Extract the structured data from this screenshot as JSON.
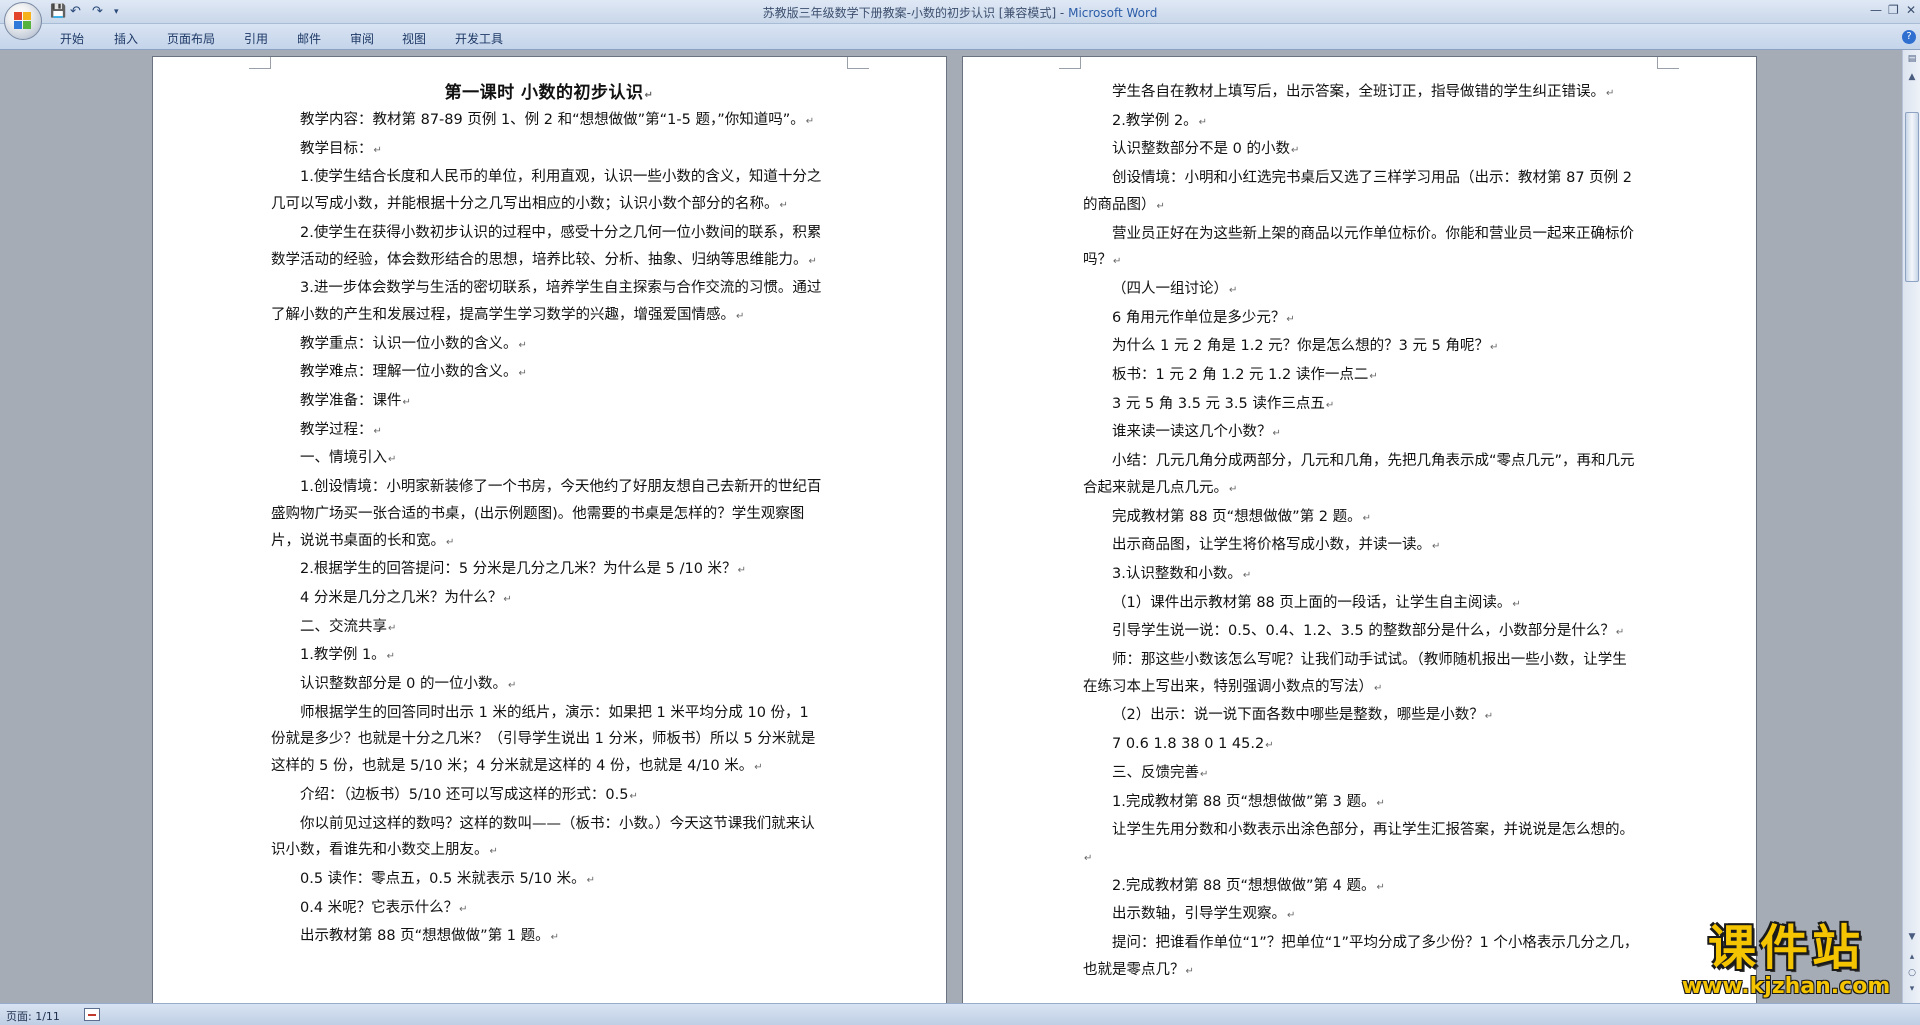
{
  "window": {
    "title_doc": "苏教版三年级数学下册教案-小数的初步认识 [兼容模式] - ",
    "title_app": "Microsoft Word"
  },
  "ribbon": {
    "tabs": [
      "开始",
      "插入",
      "页面布局",
      "引用",
      "邮件",
      "审阅",
      "视图",
      "开发工具"
    ]
  },
  "left_page": {
    "heading": "第一课时    小数的初步认识",
    "paragraphs": [
      {
        "text": "教学内容：教材第 87-89 页例 1、例 2 和“想想做做”第“1-5 题，”你知道吗”。",
        "indent": true
      },
      {
        "text": "教学目标：",
        "indent": true
      },
      {
        "text": "1.使学生结合长度和人民币的单位，利用直观，认识一些小数的含义，知道十分之几可以写成小数，并能根据十分之几写出相应的小数；认识小数个部分的名称。",
        "indent": true
      },
      {
        "text": "2.使学生在获得小数初步认识的过程中，感受十分之几何一位小数间的联系，积累数学活动的经验，体会数形结合的思想，培养比较、分析、抽象、归纳等思维能力。",
        "indent": true
      },
      {
        "text": "3.进一步体会数学与生活的密切联系，培养学生自主探索与合作交流的习惯。通过了解小数的产生和发展过程，提高学生学习数学的兴趣，增强爱国情感。",
        "indent": true
      },
      {
        "text": "教学重点：认识一位小数的含义。",
        "indent": true
      },
      {
        "text": "教学难点：理解一位小数的含义。",
        "indent": true
      },
      {
        "text": "教学准备：课件",
        "indent": true
      },
      {
        "text": "教学过程：",
        "indent": true
      },
      {
        "text": "一、情境引入",
        "indent": true
      },
      {
        "text": "1.创设情境：小明家新装修了一个书房，今天他约了好朋友想自己去新开的世纪百盛购物广场买一张合适的书桌，(出示例题图)。他需要的书桌是怎样的？学生观察图片，说说书桌面的长和宽。",
        "indent": true
      },
      {
        "text": "2.根据学生的回答提问：5 分米是几分之几米？为什么是 5 /10 米？",
        "indent": true
      },
      {
        "text": "4 分米是几分之几米？为什么？",
        "indent": true
      },
      {
        "text": "二、交流共享",
        "indent": true
      },
      {
        "text": "1.教学例 1。",
        "indent": true
      },
      {
        "text": "认识整数部分是 0 的一位小数。",
        "indent": true
      },
      {
        "text": "师根据学生的回答同时出示 1 米的纸片，演示：如果把 1 米平均分成 10 份，1 份就是多少？也就是十分之几米？（引导学生说出 1 分米，师板书）所以 5 分米就是这样的 5 份，也就是 5/10 米；4 分米就是这样的 4 份，也就是 4/10 米。",
        "indent": true
      },
      {
        "text": "介绍：（边板书）5/10 还可以写成这样的形式：0.5",
        "indent": true
      },
      {
        "text": "你以前见过这样的数吗？这样的数叫——（板书：小数。）今天这节课我们就来认识小数，看谁先和小数交上朋友。",
        "indent": true
      },
      {
        "text": "0.5 读作：零点五，0.5 米就表示 5/10 米。",
        "indent": true
      },
      {
        "text": "0.4 米呢？它表示什么？",
        "indent": true
      },
      {
        "text": "出示教材第 88 页“想想做做”第 1 题。",
        "indent": true
      }
    ]
  },
  "right_page": {
    "paragraphs": [
      {
        "text": "学生各自在教材上填写后，出示答案，全班订正，指导做错的学生纠正错误。",
        "indent": true
      },
      {
        "text": "2.教学例 2。",
        "indent": true
      },
      {
        "text": "认识整数部分不是 0 的小数",
        "indent": true
      },
      {
        "text": "创设情境：小明和小红选完书桌后又选了三样学习用品（出示：教材第 87 页例 2 的商品图）",
        "indent": true
      },
      {
        "text": "营业员正好在为这些新上架的商品以元作单位标价。你能和营业员一起来正确标价吗？",
        "indent": true
      },
      {
        "text": "（四人一组讨论）",
        "indent": true
      },
      {
        "text": "6 角用元作单位是多少元？",
        "indent": true
      },
      {
        "text": "为什么 1 元 2 角是 1.2 元？你是怎么想的？3 元 5 角呢？",
        "indent": true
      },
      {
        "text": "板书：1 元 2 角  1.2 元  1.2 读作一点二",
        "indent": true
      },
      {
        "text": "3 元 5 角  3.5 元  3.5 读作三点五",
        "indent": true
      },
      {
        "text": "谁来读一读这几个小数？",
        "indent": true
      },
      {
        "text": "小结：几元几角分成两部分，几元和几角，先把几角表示成“零点几元”，再和几元合起来就是几点几元。",
        "indent": true
      },
      {
        "text": "完成教材第 88 页“想想做做”第 2 题。",
        "indent": true
      },
      {
        "text": "出示商品图，让学生将价格写成小数，并读一读。",
        "indent": true
      },
      {
        "text": "3.认识整数和小数。",
        "indent": true
      },
      {
        "text": "（1）课件出示教材第 88 页上面的一段话，让学生自主阅读。",
        "indent": true
      },
      {
        "text": "引导学生说一说：0.5、0.4、1.2、3.5 的整数部分是什么，小数部分是什么？",
        "indent": true
      },
      {
        "text": "师：那这些小数该怎么写呢？让我们动手试试。（教师随机报出一些小数，让学生在练习本上写出来，特别强调小数点的写法）",
        "indent": true
      },
      {
        "text": "（2）出示：说一说下面各数中哪些是整数，哪些是小数？",
        "indent": true
      },
      {
        "text": "7  0.6  1.8  38  0  1  45.2",
        "indent": true
      },
      {
        "text": "三、反馈完善",
        "indent": true
      },
      {
        "text": "1.完成教材第 88 页“想想做做”第 3 题。",
        "indent": true
      },
      {
        "text": "让学生先用分数和小数表示出涂色部分，再让学生汇报答案，并说说是怎么想的。",
        "indent": true
      },
      {
        "text": "2.完成教材第 88 页“想想做做”第 4 题。",
        "indent": true
      },
      {
        "text": "出示数轴，引导学生观察。",
        "indent": true
      },
      {
        "text": "提问：把谁看作单位“1”？把单位“1”平均分成了多少份？1 个小格表示几分之几，也就是零点几？",
        "indent": true
      }
    ]
  },
  "statusbar": {
    "page_counter": "页面: 1/11"
  },
  "watermark": {
    "main": "课件站",
    "url": "www.kjzhan.com"
  },
  "colors": {
    "word_blue": "#2a5ca8",
    "ribbon_bg": "#c4d4ea",
    "workspace_bg": "#a5acb6",
    "watermark_yellow": "#f5c400"
  },
  "icons": {
    "office": "office-logo-icon",
    "save": "save-icon",
    "undo": "undo-icon",
    "redo": "redo-icon",
    "help": "help-icon",
    "paragraph_mark": "paragraph-mark-icon"
  }
}
